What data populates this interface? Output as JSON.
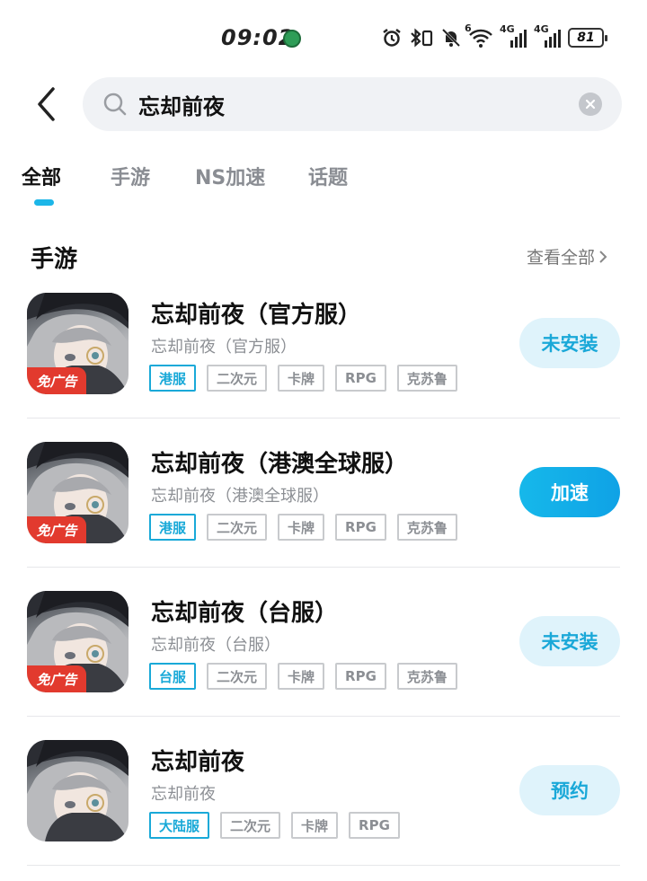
{
  "status_bar": {
    "time": "09:02",
    "network_1": "4G",
    "network_2": "4G",
    "wifi_tag": "6",
    "battery": "81"
  },
  "search": {
    "query": "忘却前夜",
    "placeholder": "",
    "icons": {
      "back": "chevron-left-icon",
      "search": "search-icon",
      "clear": "close-circle-icon"
    }
  },
  "tabs": [
    {
      "label": "全部",
      "active": true
    },
    {
      "label": "手游",
      "active": false
    },
    {
      "label": "NS加速",
      "active": false
    },
    {
      "label": "话题",
      "active": false
    }
  ],
  "section": {
    "title": "手游",
    "view_all": "查看全部"
  },
  "apps": [
    {
      "title": "忘却前夜（官方服）",
      "subtitle": "忘却前夜（官方服）",
      "ad_badge": "免广告",
      "tags": [
        "港服",
        "二次元",
        "卡牌",
        "RPG",
        "克苏鲁"
      ],
      "action": "未安装",
      "action_style": "secondary"
    },
    {
      "title": "忘却前夜（港澳全球服）",
      "subtitle": "忘却前夜（港澳全球服）",
      "ad_badge": "免广告",
      "tags": [
        "港服",
        "二次元",
        "卡牌",
        "RPG",
        "克苏鲁"
      ],
      "action": "加速",
      "action_style": "primary"
    },
    {
      "title": "忘却前夜（台服）",
      "subtitle": "忘却前夜（台服）",
      "ad_badge": "免广告",
      "tags": [
        "台服",
        "二次元",
        "卡牌",
        "RPG",
        "克苏鲁"
      ],
      "action": "未安装",
      "action_style": "secondary"
    },
    {
      "title": "忘却前夜",
      "subtitle": "忘却前夜",
      "ad_badge": "",
      "tags": [
        "大陆服",
        "二次元",
        "卡牌",
        "RPG"
      ],
      "action": "预约",
      "action_style": "secondary"
    }
  ],
  "colors": {
    "accent": "#1cb6e8",
    "ad_badge": "#e23a2e",
    "button_light": "#dff3fb"
  }
}
